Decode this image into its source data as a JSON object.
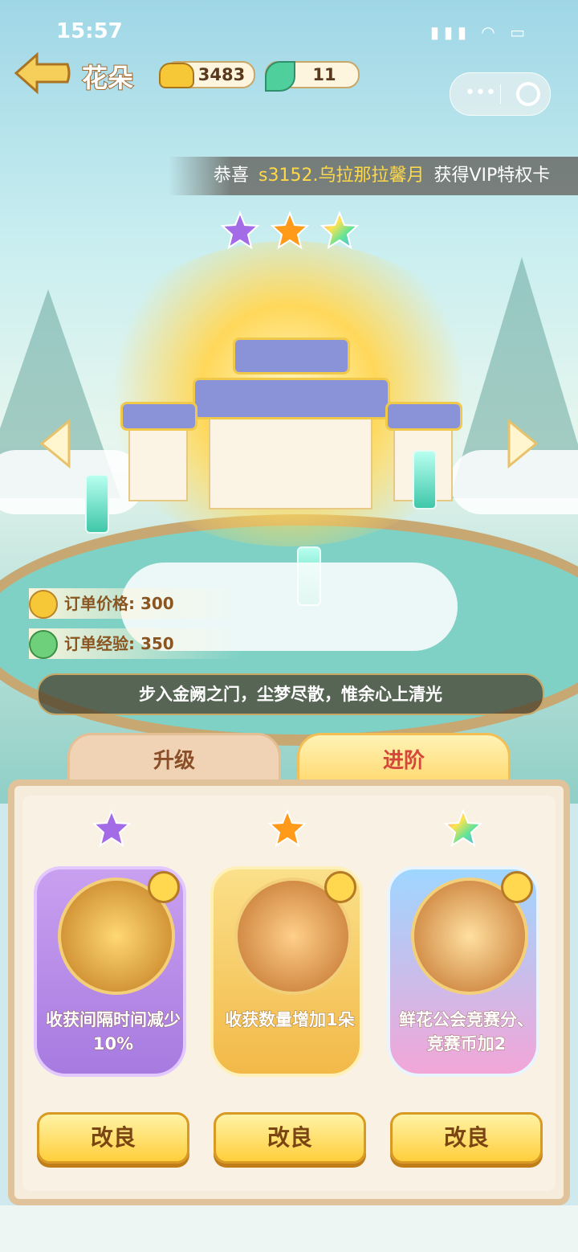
{
  "status": {
    "time": "15:57"
  },
  "header": {
    "title": "花朵",
    "gold": "3483",
    "leaf": "11"
  },
  "ticker": {
    "prefix": "恭喜",
    "player": "s3152.乌拉那拉馨月",
    "suffix": "获得VIP特权卡"
  },
  "stars": [
    {
      "icon": "purple-star-icon",
      "color": "#a46be6"
    },
    {
      "icon": "orange-star-icon",
      "color": "#ff9a1a"
    },
    {
      "icon": "rainbow-star-icon",
      "color": "#6bd4ff"
    }
  ],
  "order": {
    "price_label": "订单价格: 300",
    "exp_label": "订单经验: 350"
  },
  "quote": "步入金阙之门，尘梦尽散，惟余心上清光",
  "tabs": {
    "upgrade": "升级",
    "advance": "进阶"
  },
  "cards": [
    {
      "text": "收获间隔时间减少10%",
      "button": "改良",
      "star_color": "#a46be6"
    },
    {
      "text": "收获数量增加1朵",
      "button": "改良",
      "star_color": "#ff9a1a"
    },
    {
      "text": "鲜花公会竞赛分、竞赛币加2",
      "button": "改良",
      "star_color": "#6bd4ff"
    }
  ],
  "colors": {
    "accent": "#ffce3c",
    "purple": "#b98ae8",
    "gold": "#f4c24f",
    "rainbow": "#8fd0f0"
  }
}
